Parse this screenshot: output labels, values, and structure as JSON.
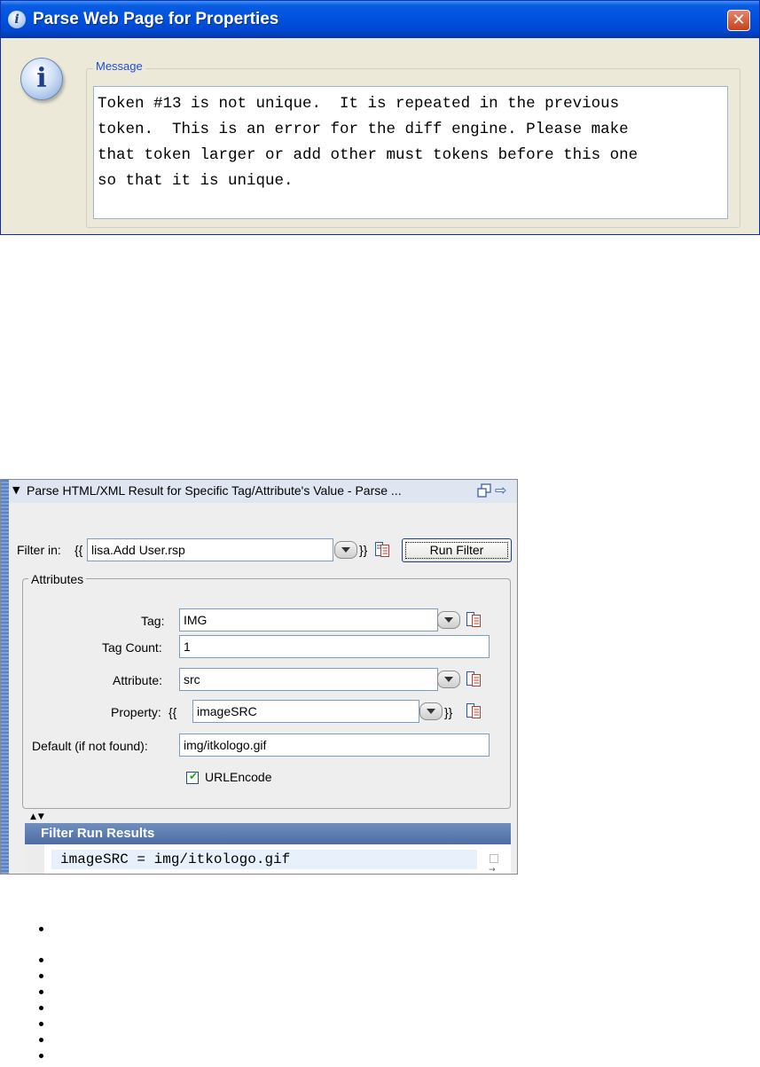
{
  "dialog": {
    "title": "Parse Web Page for Properties",
    "close_glyph": "✕",
    "title_icon": "info-icon",
    "message_legend": "Message",
    "message": "Token #13 is not unique.  It is repeated in the previous\ntoken.  This is an error for the diff engine. Please make\nthat token larger or add other must tokens before this one\nso that it is unique."
  },
  "panel": {
    "collapse_glyph": "▼",
    "title": "Parse HTML/XML Result for Specific Tag/Attribute's Value - Parse ...",
    "filter_label": "Filter in:",
    "open_brace": "{{",
    "close_brace": "}}",
    "filter_value": "lisa.Add User.rsp",
    "run_button": "Run Filter",
    "attributes_legend": "Attributes",
    "tag_label": "Tag:",
    "tag_value": "IMG",
    "tag_count_label": "Tag Count:",
    "tag_count_value": "1",
    "attribute_label": "Attribute:",
    "attribute_value": "src",
    "property_label": "Property:",
    "property_value": "imageSRC",
    "default_label": "Default (if not found):",
    "default_value": "img/itkologo.gif",
    "urlencode_label": "URLEncode",
    "urlencode_checked": true,
    "results_title": "Filter Run Results",
    "results_line": "imageSRC = img/itkologo.gif"
  },
  "colors": {
    "xp_title_blue": "#0052e0",
    "dialog_bg": "#ece9d8",
    "panel_bg": "#eeeeee",
    "results_header": "#5f7fb3"
  }
}
